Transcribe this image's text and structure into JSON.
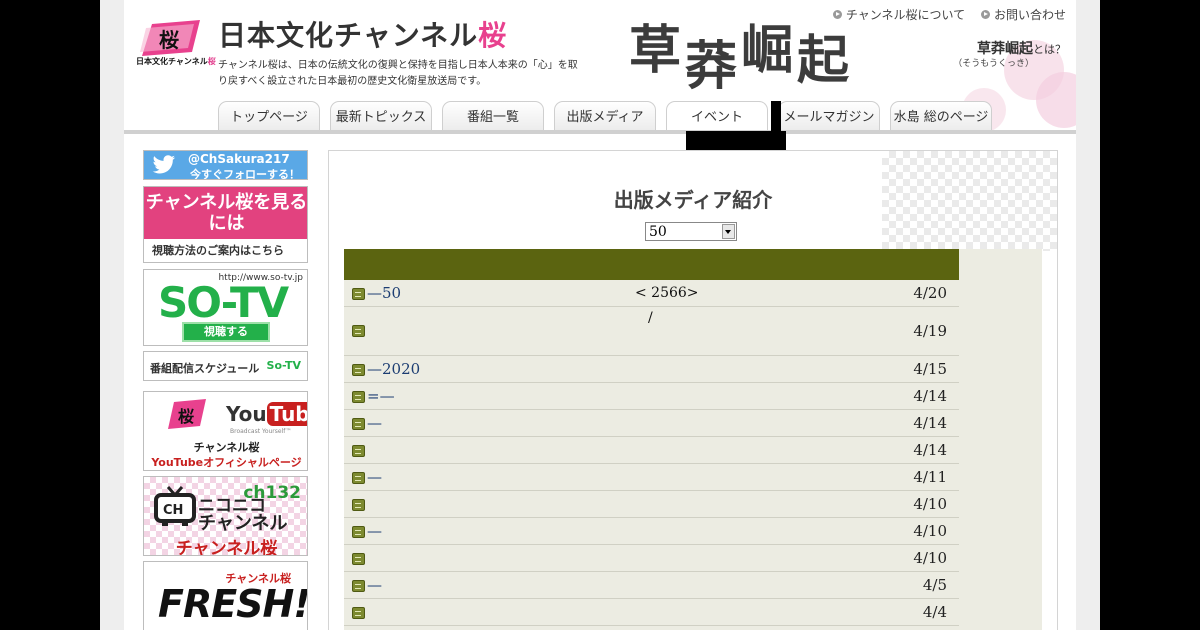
{
  "header": {
    "logo_caption_black": "日本文化チャンネル",
    "logo_caption_pink": "桜",
    "title_main": "日本文化チャンネル",
    "title_accent": "桜",
    "description": "チャンネル桜は、日本の伝統文化の復興と保持を目指し日本人本来の「心」を取り戻すべく設立された日本最初の歴史文化衛星放送局です。",
    "calligraphy": [
      "草",
      "莽",
      "崛",
      "起"
    ],
    "links": [
      {
        "label": "チャンネル桜について"
      },
      {
        "label": "お問い合わせ"
      }
    ],
    "soumou_title": "草莽崛起",
    "soumou_suffix": "とは？",
    "soumou_reading": "（そうもうくっき）"
  },
  "nav": {
    "tabs": [
      {
        "label": "トップページ"
      },
      {
        "label": "最新トピックス"
      },
      {
        "label": "番組一覧"
      },
      {
        "label": "出版メディア"
      },
      {
        "label": "イベント"
      },
      {
        "label": "メールマガジン"
      },
      {
        "label": "水島 総のページ"
      }
    ]
  },
  "sidebar": {
    "twitter": {
      "handle": "@ChSakura217",
      "follow": "今すぐフォローする！"
    },
    "watch": {
      "title": "チャンネル桜を見るには",
      "subtitle": "視聴方法のご案内はこちら"
    },
    "sotv": {
      "url": "http://www.so-tv.jp",
      "logo": "SO-TV",
      "button": "視聴する"
    },
    "schedule": {
      "label": "番組配信スケジュール",
      "logo": "So-TV"
    },
    "youtube": {
      "logo_you": "You",
      "logo_tube": "Tube",
      "sub": "Broadcast Yourself™",
      "name": "チャンネル桜",
      "page": "YouTubeオフィシャルページ"
    },
    "nico": {
      "ch": "ch132",
      "line1": "ニコニコ",
      "line2": "チャンネル",
      "line3": "チャンネル桜"
    },
    "fresh": {
      "channel": "チャンネル桜",
      "word": "FRESH!"
    }
  },
  "main": {
    "title": "出版メディア紹介",
    "select_value": "50",
    "rows": [
      {
        "title": "—50",
        "mid": "< 2566>",
        "date": "4/20"
      },
      {
        "title": "",
        "mid": "/",
        "date": "4/19"
      },
      {
        "title": "—2020",
        "mid": "",
        "date": "4/15"
      },
      {
        "title": "=—",
        "mid": "",
        "date": "4/14"
      },
      {
        "title": "—",
        "mid": "",
        "date": "4/14"
      },
      {
        "title": "",
        "mid": "",
        "date": "4/14"
      },
      {
        "title": "—",
        "mid": "",
        "date": "4/11"
      },
      {
        "title": "",
        "mid": "",
        "date": "4/10"
      },
      {
        "title": " —",
        "mid": "",
        "date": "4/10"
      },
      {
        "title": "",
        "mid": "",
        "date": "4/10"
      },
      {
        "title": "—",
        "mid": "",
        "date": "4/5"
      },
      {
        "title": "",
        "mid": "",
        "date": "4/4"
      }
    ]
  },
  "colors": {
    "accent_pink": "#e8418e",
    "table_header": "#5b6410",
    "table_bg": "#ecece2",
    "link": "#1c3d72",
    "sotv_green": "#23b04a",
    "twitter_blue": "#5aa8e6"
  }
}
